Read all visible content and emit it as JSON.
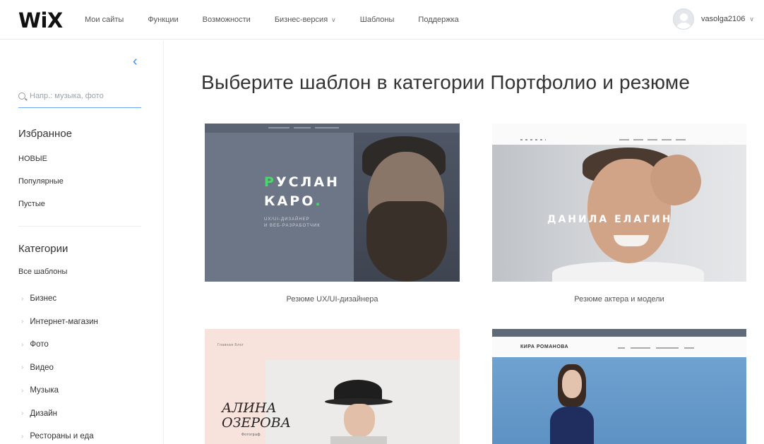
{
  "header": {
    "logo": "WiX",
    "nav": [
      {
        "label": "Мои сайты",
        "dropdown": false
      },
      {
        "label": "Функции",
        "dropdown": false
      },
      {
        "label": "Возможности",
        "dropdown": false
      },
      {
        "label": "Бизнес-версия",
        "dropdown": true
      },
      {
        "label": "Шаблоны",
        "dropdown": false
      },
      {
        "label": "Поддержка",
        "dropdown": false
      }
    ],
    "username": "vasolga2106"
  },
  "sidebar": {
    "search_placeholder": "Напр.: музыка, фото",
    "favorites_heading": "Избранное",
    "favorites": [
      "НОВЫЕ",
      "Популярные",
      "Пустые"
    ],
    "categories_heading": "Категории",
    "all_templates": "Все шаблоны",
    "categories": [
      "Бизнес",
      "Интернет-магазин",
      "Фото",
      "Видео",
      "Музыка",
      "Дизайн",
      "Рестораны и еда"
    ]
  },
  "main": {
    "title": "Выберите шаблон в категории Портфолио и резюме",
    "templates": [
      {
        "caption": "Резюме UX/UI-дизайнера",
        "thumb_name": "РУСЛАН\nКАРО.",
        "thumb_sub": "UX/UI-ДИЗАЙНЕР\nИ ВЕБ-РАЗРАБОТЧИК"
      },
      {
        "caption": "Резюме актера и модели",
        "thumb_name": "ДАНИЛА ЕЛАГИН"
      },
      {
        "caption": "",
        "thumb_name": "АЛИНА\nОЗЕРОВА",
        "thumb_role": "Фотограф",
        "thumb_nav": "Главная   Блог"
      },
      {
        "caption": "",
        "thumb_name": "КИРА РОМАНОВА"
      }
    ]
  },
  "colors": {
    "accent_blue": "#3b8fe8",
    "brand_green": "#4cd66b"
  },
  "icons": [
    "collapse-chevron-icon",
    "search-icon",
    "chevron-down-icon",
    "avatar-icon",
    "chevron-right-icon"
  ]
}
